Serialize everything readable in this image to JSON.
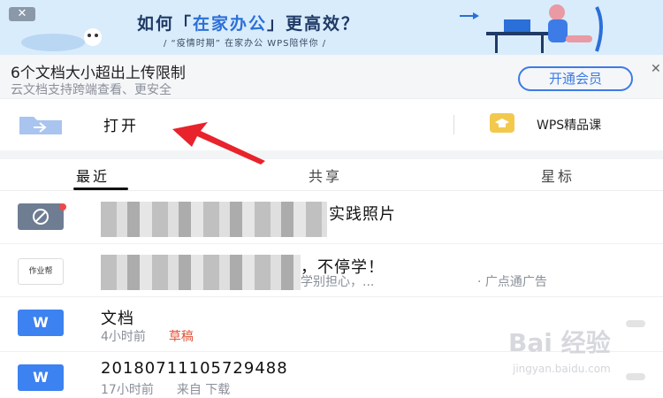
{
  "banner": {
    "close": "✕",
    "title_prefix": "如何「",
    "title_highlight": "在家办公",
    "title_suffix": "」更高效？",
    "subtitle": "/  “疫情时期” 在家办公   WPS陪伴你  /"
  },
  "upgrade": {
    "title": "6个文档大小超出上传限制",
    "subtitle": "云文档支持跨端查看、更安全",
    "button": "开通会员",
    "close": "✕"
  },
  "open_row": {
    "open_label": "打开",
    "course_label": "WPS精品课"
  },
  "tabs": {
    "recent": "最近",
    "shared": "共享",
    "starred": "星标"
  },
  "files": [
    {
      "name_visible": "实践照片",
      "icon": "photo-app-icon"
    },
    {
      "name_visible": "，不停学！",
      "meta_visible": "学别担心，...",
      "ad_label": "·  广点通广告",
      "icon_label": "作业帮"
    },
    {
      "name": "文档",
      "time": "4小时前",
      "status": "草稿",
      "icon": "W"
    },
    {
      "name": "20180711105729488",
      "time": "17小时前",
      "source": "来自 下载",
      "icon": "W"
    }
  ],
  "watermark": {
    "text": "Bai 经验",
    "sub": "jingyan.baidu.com"
  },
  "colors": {
    "accent": "#3d7be6",
    "draft": "#e0533a",
    "arrow": "#e8232b"
  }
}
